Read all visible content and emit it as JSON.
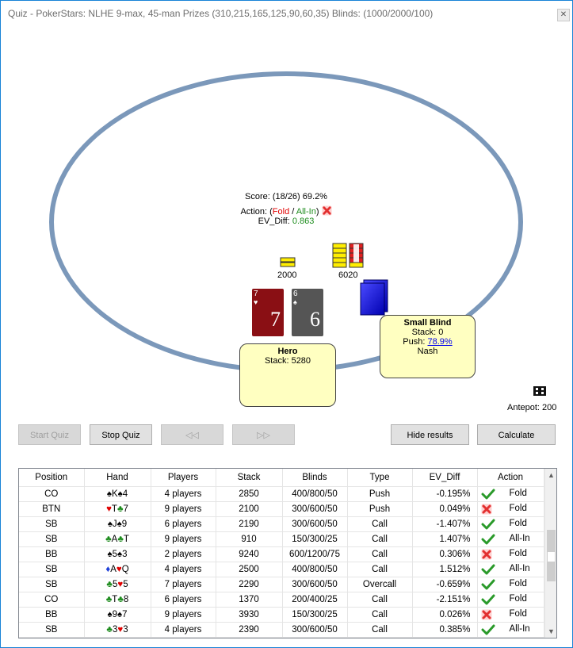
{
  "window": {
    "title": "Quiz - PokerStars: NLHE 9-max, 45-man Prizes (310,215,165,125,90,60,35) Blinds: (1000/2000/100)"
  },
  "table": {
    "score": "Score: (18/26) 69.2%",
    "action_prefix": "Action: (",
    "action_fold": "Fold",
    "action_sep": " / ",
    "action_allin": "All-In",
    "action_suffix": ")",
    "ev_diff_label": "EV_Diff: ",
    "ev_diff_value": "0.863",
    "chip_left_amount": "2000",
    "chip_right_amount": "6020",
    "hero_card_1": {
      "rank": "7",
      "suit": "♥",
      "color": "#8a0f14"
    },
    "hero_card_2": {
      "rank": "6",
      "suit": "♠",
      "color": "#555555"
    },
    "hero": {
      "name": "Hero",
      "stack": "Stack: 5280"
    },
    "small_blind": {
      "name": "Small Blind",
      "stack": "Stack: 0",
      "push_prefix": "Push: ",
      "push_pct": "78.9%",
      "note": "Nash"
    },
    "antepot": "Antepot: 200"
  },
  "buttons": {
    "start_quiz": "Start Quiz",
    "stop_quiz": "Stop Quiz",
    "prev": "◁◁",
    "next": "▷▷",
    "hide_results": "Hide results",
    "calculate": "Calculate"
  },
  "results": {
    "columns": [
      "Position",
      "Hand",
      "Players",
      "Stack",
      "Blinds",
      "Type",
      "EV_Diff",
      "Action"
    ],
    "rows": [
      {
        "position": "CO",
        "hand": [
          {
            "s": "♠",
            "r": "K",
            "c": "black"
          },
          {
            "s": "♠",
            "r": "4",
            "c": "black"
          }
        ],
        "players": "4 players",
        "stack": "2850",
        "blinds": "400/800/50",
        "type": "Push",
        "ev_diff": "-0.195%",
        "result": "correct",
        "action": "Fold"
      },
      {
        "position": "BTN",
        "hand": [
          {
            "s": "♥",
            "r": "T",
            "c": "red"
          },
          {
            "s": "♣",
            "r": "7",
            "c": "green"
          }
        ],
        "players": "9 players",
        "stack": "2100",
        "blinds": "300/600/50",
        "type": "Push",
        "ev_diff": "0.049%",
        "result": "wrong",
        "action": "Fold"
      },
      {
        "position": "SB",
        "hand": [
          {
            "s": "♠",
            "r": "J",
            "c": "black"
          },
          {
            "s": "♠",
            "r": "9",
            "c": "black"
          }
        ],
        "players": "6 players",
        "stack": "2190",
        "blinds": "300/600/50",
        "type": "Call",
        "ev_diff": "-1.407%",
        "result": "correct",
        "action": "Fold"
      },
      {
        "position": "SB",
        "hand": [
          {
            "s": "♣",
            "r": "A",
            "c": "green"
          },
          {
            "s": "♣",
            "r": "T",
            "c": "green"
          }
        ],
        "players": "9 players",
        "stack": "910",
        "blinds": "150/300/25",
        "type": "Call",
        "ev_diff": "1.407%",
        "result": "correct",
        "action": "All-In"
      },
      {
        "position": "BB",
        "hand": [
          {
            "s": "♠",
            "r": "5",
            "c": "black"
          },
          {
            "s": "♠",
            "r": "3",
            "c": "black"
          }
        ],
        "players": "2 players",
        "stack": "9240",
        "blinds": "600/1200/75",
        "type": "Call",
        "ev_diff": "0.306%",
        "result": "wrong",
        "action": "Fold"
      },
      {
        "position": "SB",
        "hand": [
          {
            "s": "♦",
            "r": "A",
            "c": "blue"
          },
          {
            "s": "♥",
            "r": "Q",
            "c": "red"
          }
        ],
        "players": "4 players",
        "stack": "2500",
        "blinds": "400/800/50",
        "type": "Call",
        "ev_diff": "1.512%",
        "result": "correct",
        "action": "All-In"
      },
      {
        "position": "SB",
        "hand": [
          {
            "s": "♣",
            "r": "5",
            "c": "green"
          },
          {
            "s": "♥",
            "r": "5",
            "c": "red"
          }
        ],
        "players": "7 players",
        "stack": "2290",
        "blinds": "300/600/50",
        "type": "Overcall",
        "ev_diff": "-0.659%",
        "result": "correct",
        "action": "Fold"
      },
      {
        "position": "CO",
        "hand": [
          {
            "s": "♣",
            "r": "T",
            "c": "green"
          },
          {
            "s": "♣",
            "r": "8",
            "c": "green"
          }
        ],
        "players": "6 players",
        "stack": "1370",
        "blinds": "200/400/25",
        "type": "Call",
        "ev_diff": "-2.151%",
        "result": "correct",
        "action": "Fold"
      },
      {
        "position": "BB",
        "hand": [
          {
            "s": "♠",
            "r": "9",
            "c": "black"
          },
          {
            "s": "♠",
            "r": "7",
            "c": "black"
          }
        ],
        "players": "9 players",
        "stack": "3930",
        "blinds": "150/300/25",
        "type": "Call",
        "ev_diff": "0.026%",
        "result": "wrong",
        "action": "Fold"
      },
      {
        "position": "SB",
        "hand": [
          {
            "s": "♣",
            "r": "3",
            "c": "green"
          },
          {
            "s": "♥",
            "r": "3",
            "c": "red"
          }
        ],
        "players": "4 players",
        "stack": "2390",
        "blinds": "300/600/50",
        "type": "Call",
        "ev_diff": "0.385%",
        "result": "correct",
        "action": "All-In"
      }
    ]
  },
  "colors": {
    "felt_ring": "#7b98ba",
    "seat_bg": "#ffffc1",
    "correct": "#2a9a2a",
    "wrong": "#e23030"
  }
}
